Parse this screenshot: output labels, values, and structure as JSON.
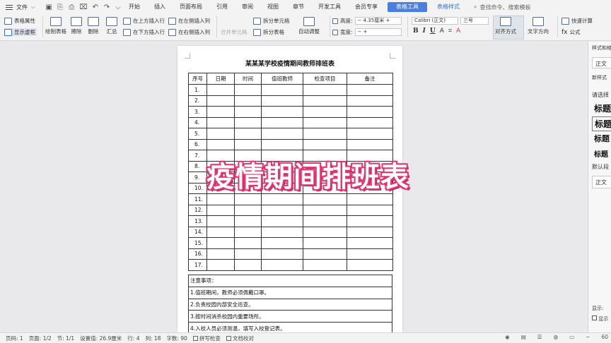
{
  "menubar": {
    "file": "文件",
    "tabs": [
      "开始",
      "插入",
      "页面布局",
      "引用",
      "审阅",
      "视图",
      "章节",
      "开发工具",
      "会员专享"
    ],
    "active_tab": "表格工具",
    "extra_tab": "表格样式",
    "search": "查找命令、搜索模板"
  },
  "ribbon": {
    "table_props": "表格属性",
    "show_grid": "显示虚框",
    "draw_table": "绘制表格",
    "erase": "擦除",
    "delete": "删除",
    "summary": "汇总",
    "insert_above": "在上方插入行",
    "insert_below": "在下方插入行",
    "insert_left": "在左侧插入列",
    "insert_right": "在右侧插入列",
    "merge_cells": "合并单元格",
    "split_cells": "拆分单元格",
    "split_table": "拆分表格",
    "autofit": "自动调整",
    "height_label": "高度:",
    "height_value": "4.35厘米",
    "width_label": "宽度:",
    "font_name": "Calibri (正文)",
    "font_size": "三号",
    "align": "对齐方式",
    "text_dir": "文字方向",
    "quick_calc": "快速计算",
    "formula": "公式"
  },
  "document": {
    "title": "某某某学校疫情期间教师排班表",
    "headers": [
      "序号",
      "日期",
      "时间",
      "值班教师",
      "检查项目",
      "备注"
    ],
    "rows": [
      "1.",
      "2.",
      "3.",
      "4.",
      "5.",
      "6.",
      "7.",
      "8.",
      "9.",
      "10.",
      "11.",
      "12.",
      "13.",
      "14.",
      "15.",
      "16.",
      "17."
    ],
    "notes_title": "注意事项：",
    "notes": [
      "1.值班期间，教师必须佩戴口罩。",
      "2.负责校园内部安全巡查。",
      "3.按时间消杀校园内重要场所。",
      "4.入校人员必须测温，填写入校登记表。"
    ]
  },
  "overlay": "疫情期间排班表",
  "pane": {
    "title": "样式和格式",
    "current": "正文",
    "new": "新样式",
    "choose": "请选择",
    "h1": "标题",
    "h2": "标题",
    "h3": "标题",
    "h4": "标题",
    "default": "默认段",
    "body": "正文",
    "show": "显示:",
    "show2": "显示"
  },
  "status": {
    "page_no": "页码: 1",
    "pages": "页面: 1/2",
    "section": "节: 1/1",
    "setting": "设置值: 26.9厘米",
    "row": "行: 4",
    "col": "列: 18",
    "words": "字数: 90",
    "spell": "拼写检查",
    "proof": "文档校对",
    "zoom": "60"
  }
}
